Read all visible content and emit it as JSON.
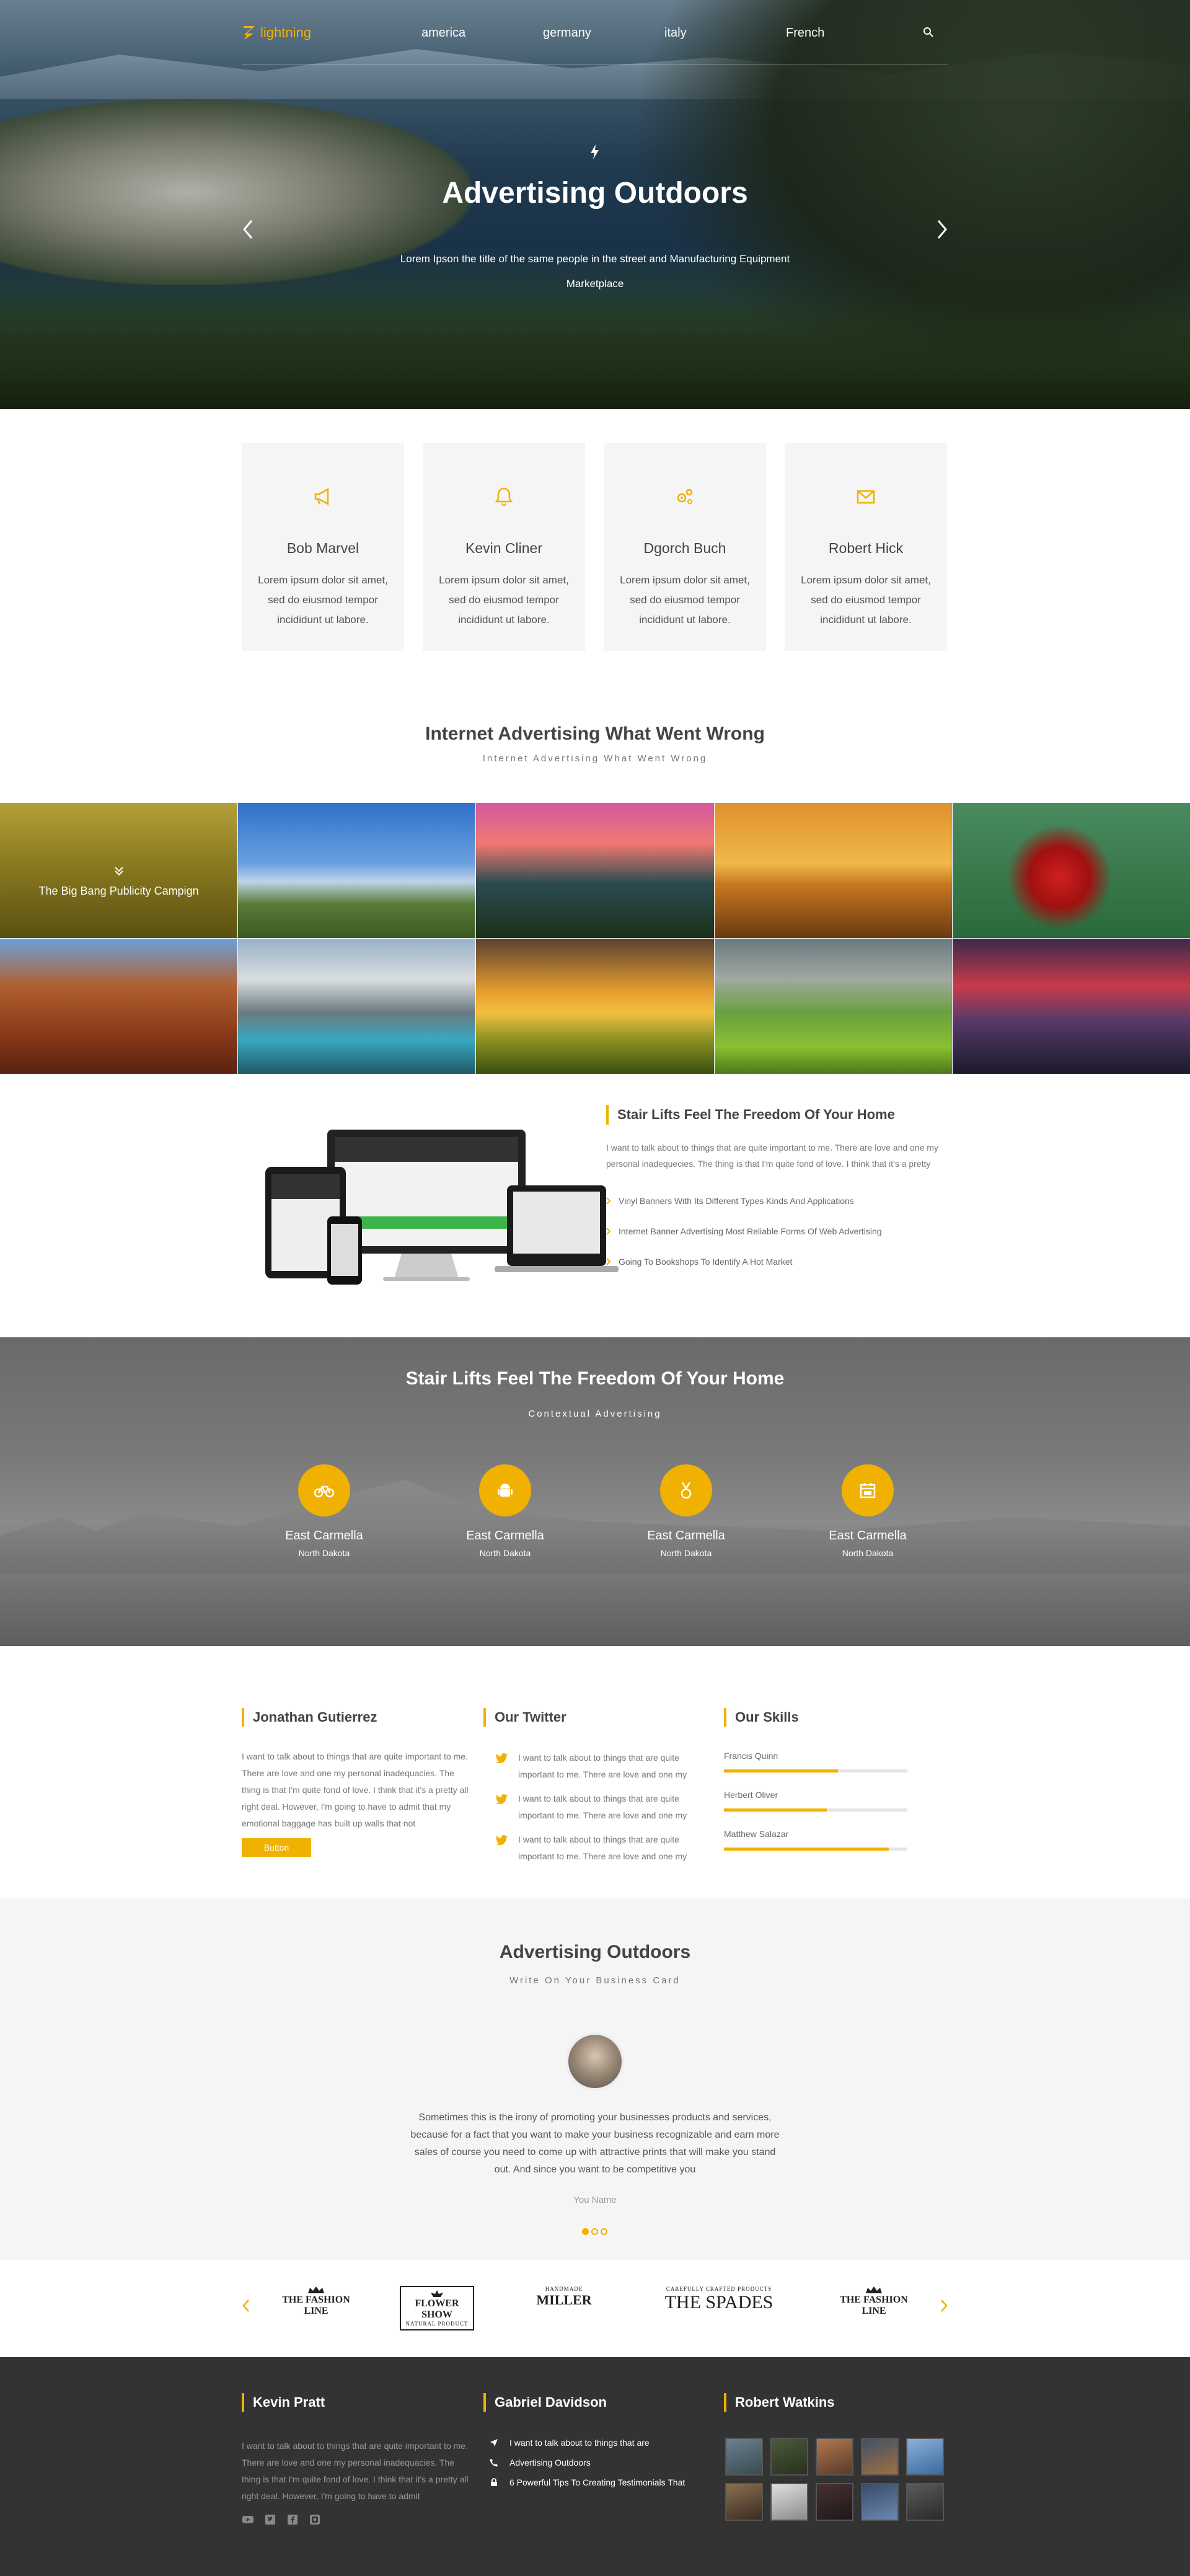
{
  "nav": {
    "logo": "lightning",
    "links": [
      "america",
      "germany",
      "italy",
      "French"
    ]
  },
  "hero": {
    "title": "Advertising Outdoors",
    "subtitle": "Lorem Ipson the title of the same people in the street and Manufacturing Equipment Marketplace"
  },
  "features": [
    {
      "icon": "megaphone-icon",
      "title": "Bob Marvel",
      "text": "Lorem ipsum dolor sit amet, sed do eiusmod tempor incididunt ut labore."
    },
    {
      "icon": "bell-icon",
      "title": "Kevin Cliner",
      "text": "Lorem ipsum dolor sit amet, sed do eiusmod tempor incididunt ut labore."
    },
    {
      "icon": "gears-icon",
      "title": "Dgorch Buch",
      "text": "Lorem ipsum dolor sit amet, sed do eiusmod tempor incididunt ut labore."
    },
    {
      "icon": "envelope-icon",
      "title": "Robert Hick",
      "text": "Lorem ipsum dolor sit amet, sed do eiusmod tempor incididunt ut labore."
    }
  ],
  "gallery_section": {
    "title": "Internet Advertising What Went Wrong",
    "subtitle": "Internet Advertising What Went Wrong",
    "first_caption": "The Big Bang Publicity Campign"
  },
  "about": {
    "title": "Stair Lifts Feel The Freedom Of Your Home",
    "text": "I want to talk about to things that are quite important to me. There are love and one my personal inadequecies. The thing is that I'm quite fond of love. I think that it's a pretty",
    "list": [
      "Vinyl Banners With Its Different Types Kinds And Applications",
      "Internet Banner Advertising Most Reliable Forms Of Web Advertising",
      "Going To Bookshops To Identify A Hot Market"
    ]
  },
  "stats": {
    "title": "Stair Lifts Feel The Freedom Of Your Home",
    "subtitle": "Contextual Advertising",
    "items": [
      {
        "icon": "bicycle-icon",
        "title": "East Carmella",
        "sub": "North Dakota"
      },
      {
        "icon": "android-icon",
        "title": "East Carmella",
        "sub": "North Dakota"
      },
      {
        "icon": "medal-icon",
        "title": "East Carmella",
        "sub": "North Dakota"
      },
      {
        "icon": "calendar-icon",
        "title": "East Carmella",
        "sub": "North Dakota"
      }
    ]
  },
  "widgets": {
    "bio_title": "Jonathan Gutierrez",
    "bio_text": "I want to talk about to things that are quite important to me. There are love and one my personal inadequacies. The thing is that I'm quite fond of love. I think that it's a pretty all right deal. However, I'm going to have to admit that my emotional baggage has built up walls that not",
    "button": "Button",
    "twitter_title": "Our Twitter",
    "tweets": [
      "I want to talk about to things that are quite important to me. There are love and one my",
      "I want to talk about to things that are quite important to me. There are love and one my",
      "I want to talk about to things that are quite important to me. There are love and one my"
    ],
    "skills_title": "Our Skills",
    "skills": [
      {
        "name": "Francis Quinn",
        "level": 0.62
      },
      {
        "name": "Herbert Oliver",
        "level": 0.56
      },
      {
        "name": "Matthew Salazar",
        "level": 0.9
      }
    ]
  },
  "testimonial": {
    "title": "Advertising Outdoors",
    "subtitle": "Write On Your Business Card",
    "quote": "Sometimes this is the irony of promoting your businesses products and services, because for a fact that you want to make your business recognizable and earn more sales of course you need to come up with attractive prints that will make you stand out. And since you want to be competitive you",
    "name": "You Name"
  },
  "brands": [
    {
      "line1": "THE FASHION LINE",
      "line2": ""
    },
    {
      "line1": "FLOWER SHOW",
      "line2": "NATURAL PRODUCT"
    },
    {
      "line1": "MILLER",
      "line2": "HANDMADE"
    },
    {
      "line1": "THE SPADES",
      "line2": "CAREFULLY CRAFTED PRODUCTS"
    },
    {
      "line1": "THE FASHION LINE",
      "line2": ""
    }
  ],
  "footer": {
    "col1_title": "Kevin Pratt",
    "col1_text": "I want to talk about to things that are quite important to me. There are love and one my personal inadequacies. The thing is that I'm quite fond of love. I think that it's a pretty all right deal. However, I'm going to have to admit",
    "col2_title": "Gabriel Davidson",
    "links": [
      {
        "icon": "location-arrow-icon",
        "text": "I want to talk about to things that are"
      },
      {
        "icon": "phone-icon",
        "text": "Advertising Outdoors"
      },
      {
        "icon": "lock-icon",
        "text": "6 Powerful Tips To Creating Testimonials That"
      }
    ],
    "col3_title": "Robert Watkins"
  },
  "colors": {
    "accent": "#f0b100",
    "footer_bg": "#333333",
    "light_bg": "#f5f5f5"
  }
}
